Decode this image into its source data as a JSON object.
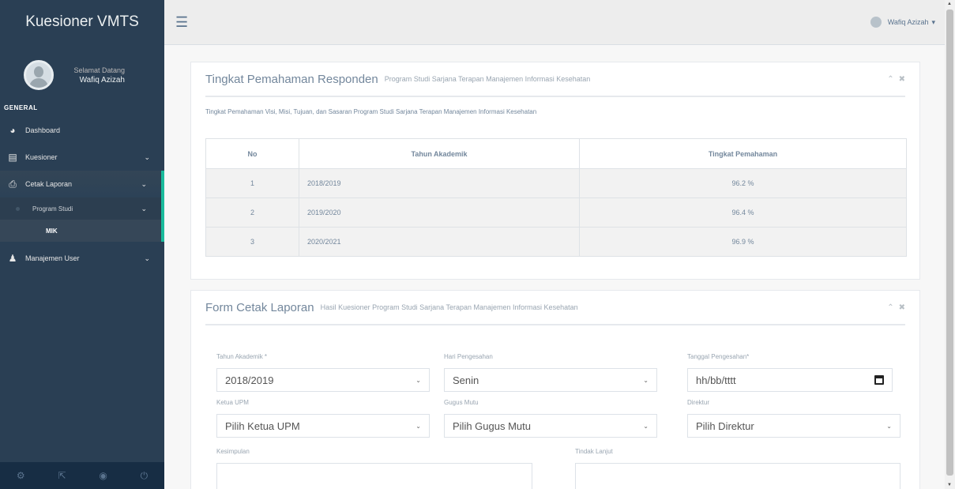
{
  "sidebar": {
    "brand": "Kuesioner VMTS",
    "welcome": "Selamat Datang",
    "user_name": "Wafiq Azizah",
    "section": "GENERAL",
    "items": [
      {
        "label": "Dashboard",
        "icon": "dashboard-icon",
        "has_chevron": false
      },
      {
        "label": "Kuesioner",
        "icon": "list-icon",
        "has_chevron": true
      },
      {
        "label": "Cetak Laporan",
        "icon": "printer-icon",
        "has_chevron": true
      },
      {
        "label": "Manajemen User",
        "icon": "user-icon",
        "has_chevron": true
      }
    ],
    "sub_items": [
      {
        "label": "Program Studi"
      },
      {
        "label": "MIK"
      }
    ],
    "footer_icons": [
      "settings-icon",
      "fullscreen-icon",
      "eye-icon",
      "power-icon"
    ]
  },
  "topnav": {
    "user_label": "Wafiq Azizah"
  },
  "panel1": {
    "title": "Tingkat Pemahaman Responden",
    "subtitle": "Program Studi Sarjana Terapan Manajemen Informasi Kesehatan",
    "description": "Tingkat Pemahaman Visi, Misi, Tujuan, dan Sasaran Program Studi Sarjana Terapan Manajemen Informasi Kesehatan",
    "table": {
      "headers": [
        "No",
        "Tahun Akademik",
        "Tingkat Pemahaman"
      ],
      "rows": [
        [
          "1",
          "2018/2019",
          "96.2 %"
        ],
        [
          "2",
          "2019/2020",
          "96.4 %"
        ],
        [
          "3",
          "2020/2021",
          "96.9 %"
        ]
      ]
    }
  },
  "panel2": {
    "title": "Form Cetak Laporan",
    "subtitle": "Hasil Kuesioner Program Studi Sarjana Terapan Manajemen Informasi Kesehatan",
    "fields": {
      "tahun_akademik": {
        "label": "Tahun Akademik *",
        "value": "2018/2019"
      },
      "hari_pengesahan": {
        "label": "Hari Pengesahan",
        "value": "Senin"
      },
      "tanggal_pengesahan": {
        "label": "Tanggal Pengesahan*",
        "value": "hh/bb/tttt"
      },
      "ketua_upm": {
        "label": "Ketua UPM",
        "value": "Pilih Ketua UPM"
      },
      "gugus_mutu": {
        "label": "Gugus Mutu",
        "value": "Pilih Gugus Mutu"
      },
      "direktur": {
        "label": "Direktur",
        "value": "Pilih Direktur"
      },
      "kesimpulan": {
        "label": "Kesimpulan"
      },
      "tindak_lanjut": {
        "label": "Tindak Lanjut"
      }
    }
  },
  "colors": {
    "sidebar_bg": "#2a3f54",
    "accent": "#1abb9c",
    "topnav_bg": "#ededed"
  }
}
